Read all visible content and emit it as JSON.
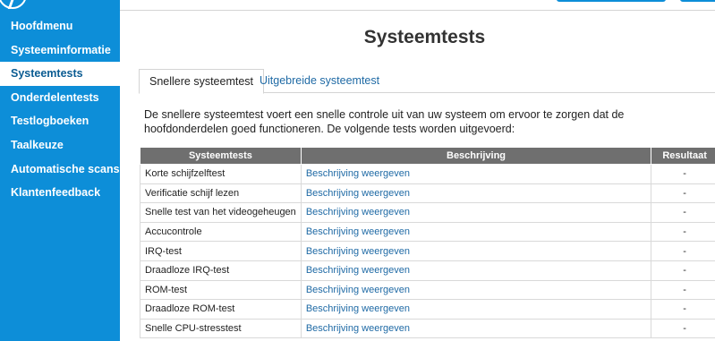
{
  "sidebar": {
    "items": [
      {
        "label": "Hoofdmenu",
        "active": false
      },
      {
        "label": "Systeeminformatie",
        "active": false
      },
      {
        "label": "Systeemtests",
        "active": true
      },
      {
        "label": "Onderdelentests",
        "active": false
      },
      {
        "label": "Testlogboeken",
        "active": false
      },
      {
        "label": "Taalkeuze",
        "active": false
      },
      {
        "label": "Automatische scans",
        "active": false
      },
      {
        "label": "Klantenfeedback",
        "active": false
      }
    ]
  },
  "main": {
    "title": "Systeemtests",
    "tabs": [
      {
        "label": "Snellere systeemtest",
        "active": true
      },
      {
        "label": "Uitgebreide systeemtest",
        "active": false
      }
    ],
    "intro": "De snellere systeemtest voert een snelle controle uit van uw systeem om ervoor te zorgen dat de hoofdonderdelen goed functioneren. De volgende tests worden uitgevoerd:"
  },
  "table": {
    "headers": [
      "Systeemtests",
      "Beschrijving",
      "Resultaat"
    ],
    "rows": [
      {
        "test": "Korte schijfzelftest",
        "description": "Beschrijving weergeven",
        "result": "-"
      },
      {
        "test": "Verificatie schijf lezen",
        "description": "Beschrijving weergeven",
        "result": "-"
      },
      {
        "test": "Snelle test van het videogeheugen",
        "description": "Beschrijving weergeven",
        "result": "-"
      },
      {
        "test": "Accucontrole",
        "description": "Beschrijving weergeven",
        "result": "-"
      },
      {
        "test": "IRQ-test",
        "description": "Beschrijving weergeven",
        "result": "-"
      },
      {
        "test": "Draadloze IRQ-test",
        "description": "Beschrijving weergeven",
        "result": "-"
      },
      {
        "test": "ROM-test",
        "description": "Beschrijving weergeven",
        "result": "-"
      },
      {
        "test": "Draadloze ROM-test",
        "description": "Beschrijving weergeven",
        "result": "-"
      },
      {
        "test": "Snelle CPU-stresstest",
        "description": "Beschrijving weergeven",
        "result": "-"
      }
    ]
  },
  "colors": {
    "sidebar": "#0d8ed8",
    "active_nav_text": "#0b5c92",
    "link": "#1f6aa5",
    "table_header": "#6f6f6f"
  },
  "icons": {
    "logo": "hp-logo-icon"
  }
}
